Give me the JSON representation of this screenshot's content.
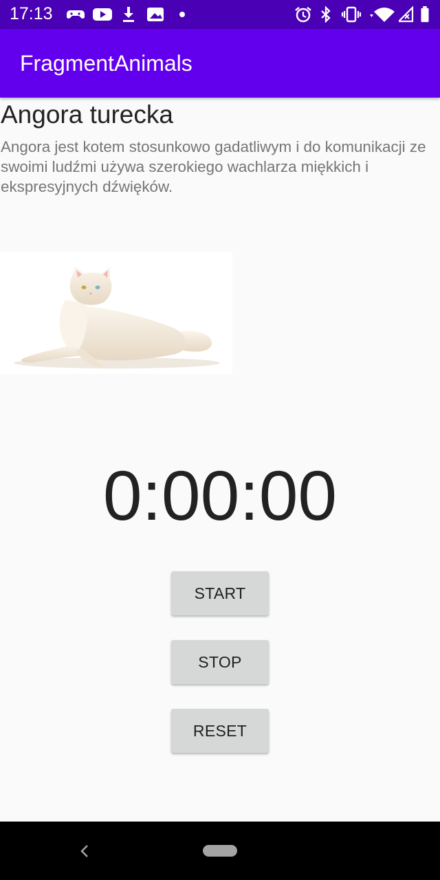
{
  "status_bar": {
    "time": "17:13",
    "left_icons": [
      "gamepad-icon",
      "youtube-icon",
      "download-icon",
      "gallery-icon",
      "dot-icon"
    ],
    "right_icons": [
      "alarm-icon",
      "bluetooth-icon",
      "vibrate-icon",
      "wifi-icon",
      "signal-icon",
      "battery-icon"
    ]
  },
  "app_bar": {
    "title": "FragmentAnimals"
  },
  "detail": {
    "name": "Angora turecka",
    "description": "Angora jest kotem stosunkowo gadatliwym i do komunikacji ze swoimi ludźmi używa szerokiego wachlarza miękkich i ekspresyjnych dźwięków.",
    "image": "white-angora-cat-photo"
  },
  "stopwatch": {
    "time": "0:00:00",
    "start_label": "START",
    "stop_label": "STOP",
    "reset_label": "RESET"
  },
  "nav_bar": {
    "icons": [
      "back-icon",
      "home-pill-icon"
    ]
  },
  "colors": {
    "status_bar": "#4a00b4",
    "app_bar": "#6200ee",
    "background": "#fafafa",
    "button": "#d6d7d7",
    "description_text": "#757575"
  }
}
